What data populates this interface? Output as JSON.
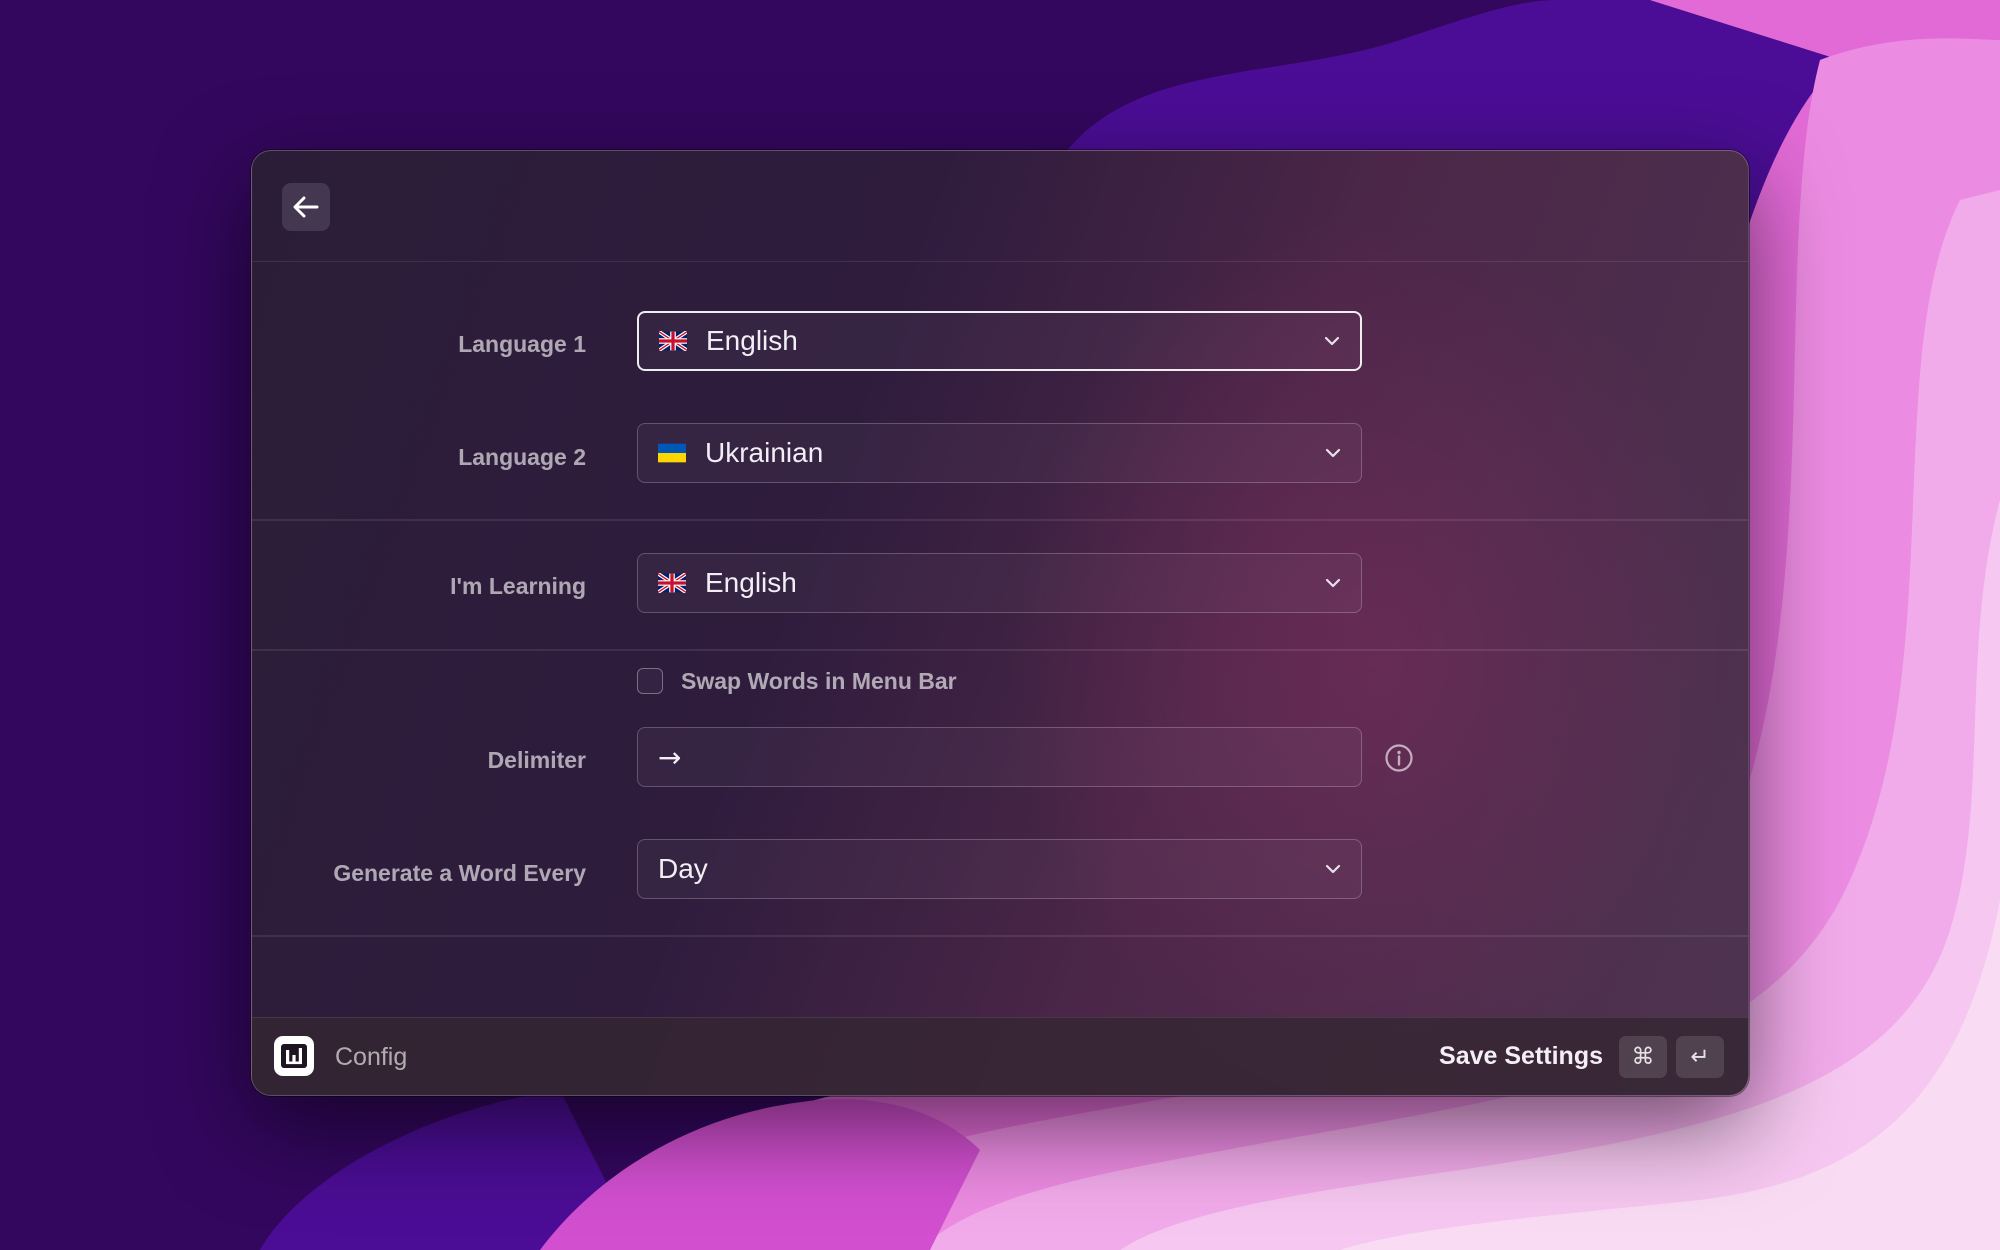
{
  "window": {
    "back_icon": "arrow-left-icon"
  },
  "form": {
    "language1": {
      "label": "Language 1",
      "value": "English",
      "flag": "gb-flag-icon"
    },
    "language2": {
      "label": "Language 2",
      "value": "Ukrainian",
      "flag": "ua-flag-icon"
    },
    "learning": {
      "label": "I'm Learning",
      "value": "English",
      "flag": "gb-flag-icon"
    },
    "swap_words": {
      "label": "Swap Words in Menu Bar",
      "checked": false
    },
    "delimiter": {
      "label": "Delimiter",
      "value": "→",
      "info_icon": "info-icon"
    },
    "frequency": {
      "label": "Generate a Word Every",
      "value": "Day"
    }
  },
  "footer": {
    "app_icon": "app-logo-icon",
    "title": "Config",
    "save_label": "Save Settings",
    "shortcut_keys": [
      "⌘",
      "↵"
    ]
  },
  "colors": {
    "wallpaper_dark": "#33075e",
    "wallpaper_pink": "#e86fd8",
    "panel": "#2f1c3d"
  }
}
